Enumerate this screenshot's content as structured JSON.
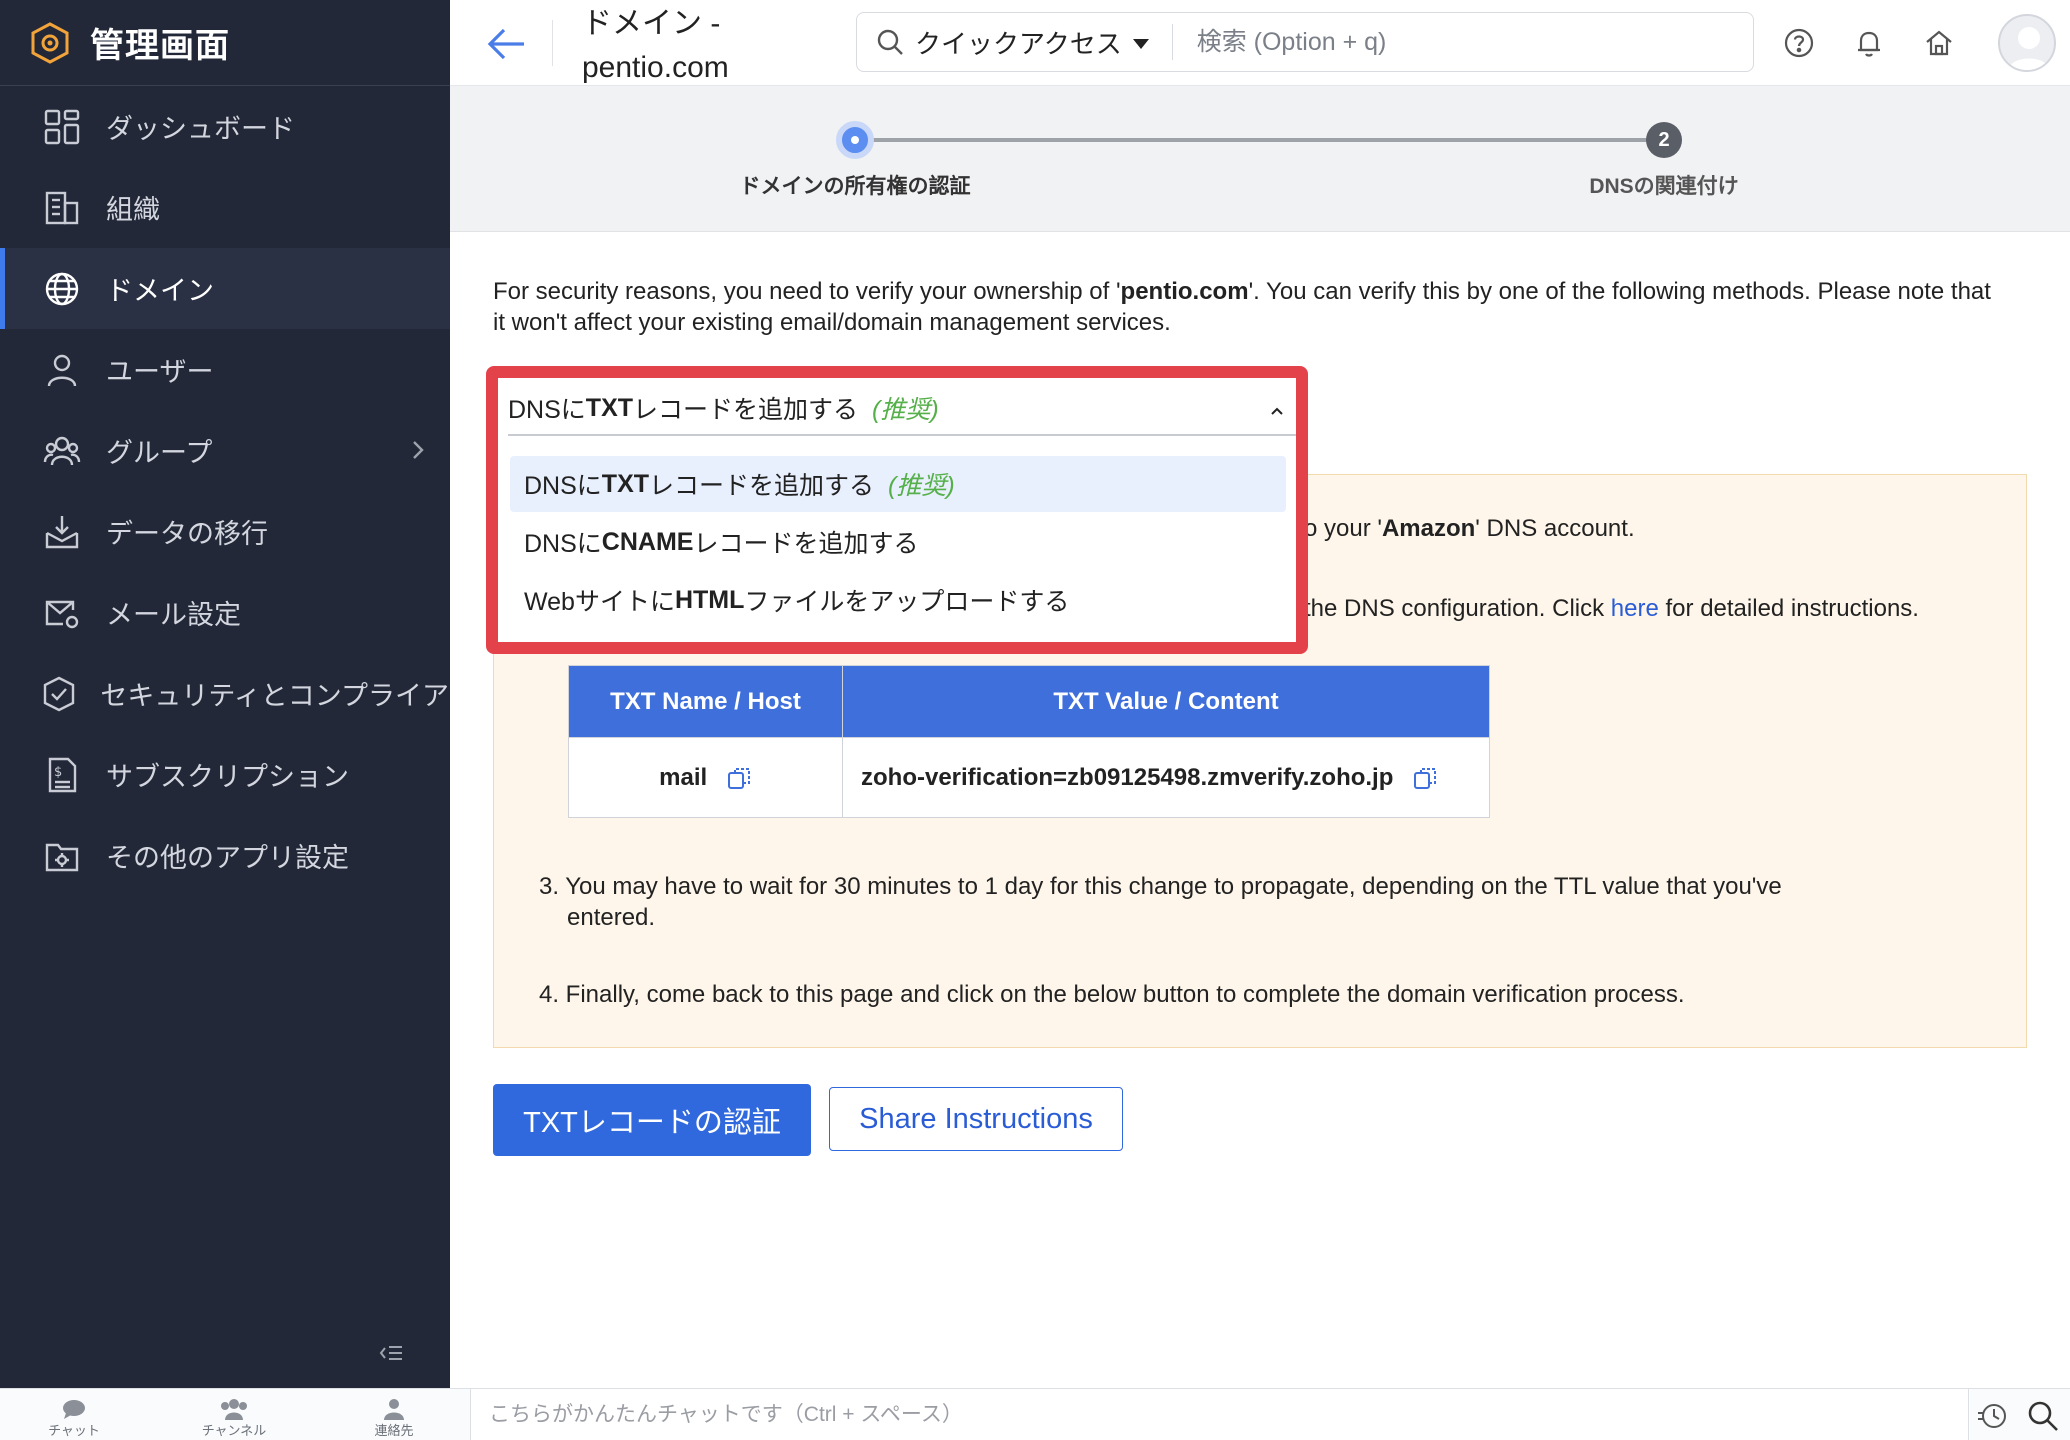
{
  "app": {
    "title": "管理画面"
  },
  "sidebar": {
    "items": [
      {
        "label": "ダッシュボード",
        "icon": "dashboard-icon"
      },
      {
        "label": "組織",
        "icon": "building-icon"
      },
      {
        "label": "ドメイン",
        "icon": "globe-icon",
        "active": true
      },
      {
        "label": "ユーザー",
        "icon": "user-icon"
      },
      {
        "label": "グループ",
        "icon": "group-icon",
        "has_children": true
      },
      {
        "label": "データの移行",
        "icon": "import-icon"
      },
      {
        "label": "メール設定",
        "icon": "mail-settings-icon"
      },
      {
        "label": "セキュリティとコンプライアンス",
        "icon": "shield-icon"
      },
      {
        "label": "サブスクリプション",
        "icon": "subscription-icon"
      },
      {
        "label": "その他のアプリ設定",
        "icon": "folder-settings-icon"
      }
    ]
  },
  "header": {
    "title": "ドメイン - pentio.com",
    "quick_access": "クイックアクセス",
    "search_placeholder": "検索 (Option + q)"
  },
  "stepper": {
    "steps": [
      {
        "label": "ドメインの所有権の認証",
        "state": "current"
      },
      {
        "number": "2",
        "label": "DNSの関連付け",
        "state": "pending"
      }
    ]
  },
  "intro": {
    "part1": "For security reasons, you need to verify your ownership of '",
    "domain": "pentio.com",
    "part2": "'. You can verify this by one of the following methods. Please note that it won't affect your existing email/domain management services."
  },
  "method_dropdown": {
    "selected_prefix": "DNSに",
    "selected_bold": "TXT",
    "selected_suffix": "レコードを追加する",
    "recommended": "(推奨)",
    "options": [
      {
        "prefix": "DNSに",
        "bold": "TXT",
        "suffix": "レコードを追加する",
        "tag": "(推奨)"
      },
      {
        "prefix": "DNSに",
        "bold": "CNAME",
        "suffix": "レコードを追加する",
        "tag": ""
      },
      {
        "prefix": "Webサイトに",
        "bold": "HTML",
        "suffix": "ファイルをアップロードする",
        "tag": ""
      }
    ]
  },
  "instructions": {
    "line1_pre": "o your '",
    "line1_bold": "Amazon",
    "line1_post": "' DNS account.",
    "line2_pre": "the DNS configuration. Click ",
    "line2_link": "here",
    "line2_post": " for detailed instructions.",
    "table": {
      "headers": [
        "TXT Name / Host",
        "TXT Value / Content"
      ],
      "host": "mail",
      "value": "zoho-verification=zb09125498.zmverify.zoho.jp"
    },
    "step3": "3. You may have to wait for 30 minutes to 1 day for this change to propagate, depending on the TTL value that you've",
    "step3_cont": "entered.",
    "step4": "4. Finally, come back to this page and click on the below button to complete the domain verification process."
  },
  "buttons": {
    "verify": "TXTレコードの認証",
    "share": "Share Instructions"
  },
  "bottom_bar": {
    "tabs": [
      "チャット",
      "チャンネル",
      "連絡先"
    ],
    "chat_placeholder": "こちらがかんたんチャットです（Ctrl + スペース）"
  },
  "colors": {
    "sidebar_bg": "#222838",
    "accent": "#3068dd",
    "highlight": "#e4424b",
    "recommended": "#56b04a"
  }
}
